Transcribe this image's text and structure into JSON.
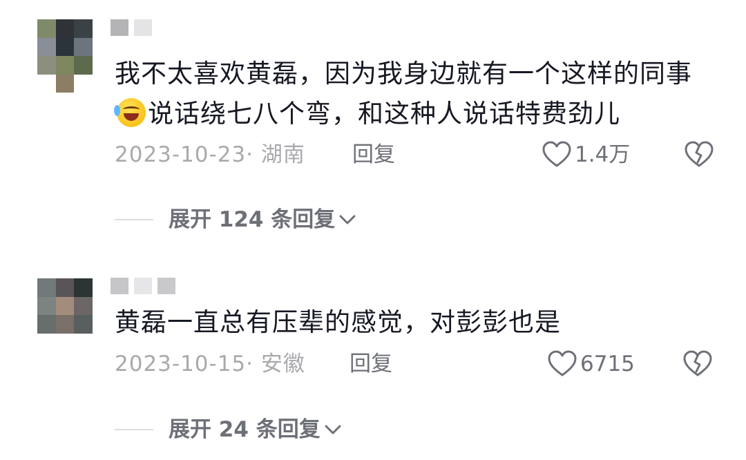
{
  "comments": [
    {
      "avatar_colors": [
        "#7f8a6a",
        "#2f3236",
        "#3b4246",
        "#8a8e96",
        "#2b333b",
        "#6c747e",
        "#8c8f7e",
        "#7e8760",
        "#5d6a4c",
        "#ffffff",
        "#8b7e64",
        "#ffffff"
      ],
      "name_colors": [
        "#b4b4b6",
        "#e4e4e6"
      ],
      "text_before_emoji": "我不太喜欢黄磊，因为我身边就有一个这样的同事",
      "emoji": "laughing-crying-emoji",
      "text_after_emoji": "说话绕七八个弯，和这种人说话特费劲儿",
      "date": "2023-10-23· 湖南",
      "reply": "回复",
      "likes": "1.4万",
      "expand": "展开 124 条回复"
    },
    {
      "avatar_colors": [
        "#72797a",
        "#5a5458",
        "#2d3434",
        "#7d8380",
        "#a48c7c",
        "#6c6666",
        "#686e6c",
        "#7b6f69",
        "#595e5e"
      ],
      "name_colors": [
        "#c6c6c8",
        "#e6e6e8",
        "#c9c9cb"
      ],
      "text": "黄磊一直总有压辈的感觉，对彭彭也是",
      "date": "2023-10-15· 安徽",
      "reply": "回复",
      "likes": "6715",
      "expand": "展开 24 条回复"
    }
  ]
}
